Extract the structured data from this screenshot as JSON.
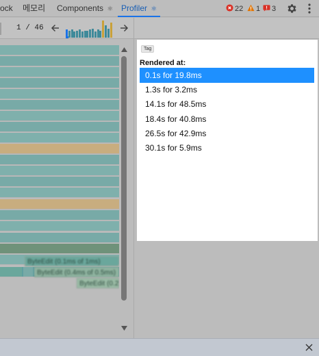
{
  "tabs": [
    {
      "label": "ock",
      "icon": ""
    },
    {
      "label": "메모리",
      "icon": ""
    },
    {
      "label": "Components",
      "icon": "⚛"
    },
    {
      "label": "Profiler",
      "icon": "⚛"
    }
  ],
  "active_tab": "Profiler",
  "issues": {
    "errors": "22",
    "warnings": "1",
    "issues": "3"
  },
  "toolbar": {
    "commit_position": "1 / 46"
  },
  "commit_chart": {
    "selected_index": 0,
    "bar_heights": [
      0.45,
      0.4,
      0.45,
      0.35,
      0.4,
      0.45,
      0.35,
      0.4,
      0.4,
      0.45,
      0.5,
      0.35,
      0.45,
      0.4,
      0.95,
      0.7,
      0.5,
      0.85
    ],
    "colors": {
      "normal": "#3f8a9a",
      "selected": "#1a73e8",
      "highlight": "#c9a13a"
    }
  },
  "details": {
    "tag": "Tag",
    "rendered_at_label": "Rendered at:",
    "commits": [
      {
        "label": "0.1s for 19.8ms",
        "selected": true
      },
      {
        "label": "1.3s for 3.2ms",
        "selected": false
      },
      {
        "label": "14.1s for 48.5ms",
        "selected": false
      },
      {
        "label": "18.4s for 40.8ms",
        "selected": false
      },
      {
        "label": "26.5s for 42.9ms",
        "selected": false
      },
      {
        "label": "30.1s for 5.9ms",
        "selected": false
      }
    ]
  },
  "colors": {
    "accent": "#1a73e8",
    "selected_row": "#1e90ff",
    "flame_teal": "#78aaa7",
    "flame_gold": "#c8ad7f",
    "flame_green": "#6f927a"
  }
}
